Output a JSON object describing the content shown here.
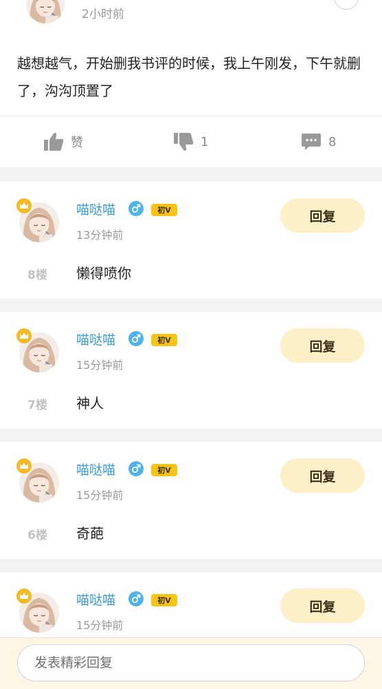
{
  "post": {
    "time": "2小时前",
    "body": "越想越气，开始删我书评的时候，我上午刚发，下午就删了，沟沟顶置了",
    "actions": {
      "like_label": "赞",
      "dislike_count": "1",
      "comment_count": "8"
    }
  },
  "comments": [
    {
      "name": "喵哒喵",
      "badge": "初V",
      "time": "13分钟前",
      "reply_label": "回复",
      "floor": "8楼",
      "text": "懒得喷你"
    },
    {
      "name": "喵哒喵",
      "badge": "初V",
      "time": "15分钟前",
      "reply_label": "回复",
      "floor": "7楼",
      "text": "神人"
    },
    {
      "name": "喵哒喵",
      "badge": "初V",
      "time": "15分钟前",
      "reply_label": "回复",
      "floor": "6楼",
      "text": "奇葩"
    },
    {
      "name": "喵哒喵",
      "badge": "初V",
      "time": "15分钟前",
      "reply_label": "回复"
    }
  ],
  "reply_bar": {
    "placeholder": "发表精彩回复"
  },
  "colors": {
    "accent_name": "#3a9bd6",
    "reply_button_bg": "#fdf0c8",
    "vip_badge": "#f6c419",
    "crown": "#f6b926",
    "page_bg": "#f2f2f2"
  },
  "icons": [
    "thumbs-up-icon",
    "thumbs-down-icon",
    "comment-icon",
    "crown-icon",
    "male-icon",
    "more-icon",
    "avatar"
  ]
}
